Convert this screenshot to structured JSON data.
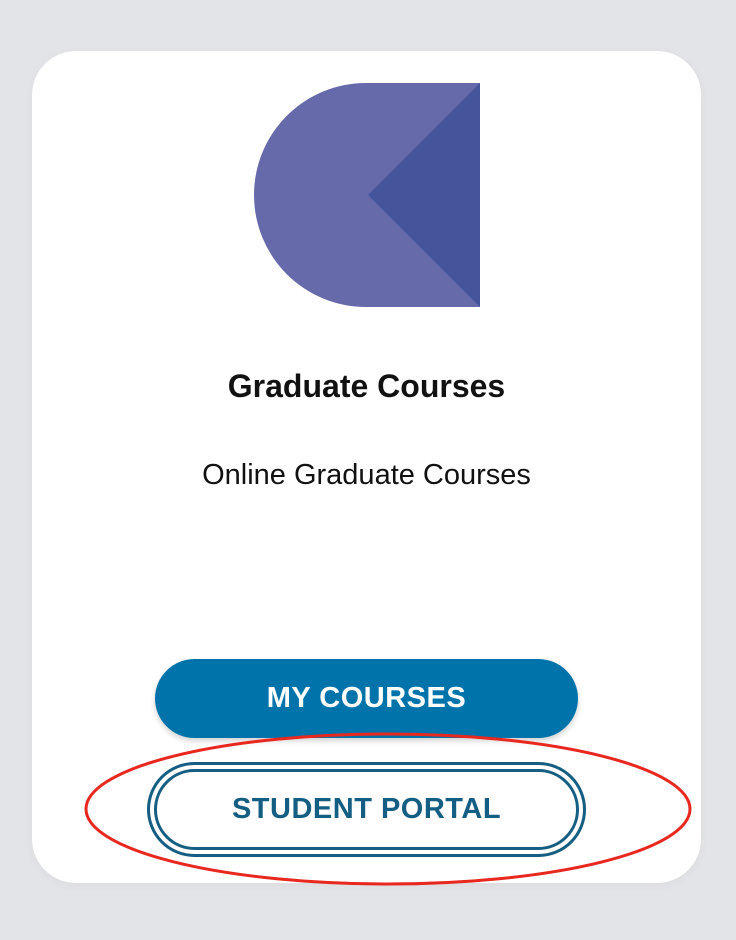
{
  "card": {
    "title": "Graduate Courses",
    "subtitle": "Online Graduate Courses",
    "logo_icon": "graduate-courses-logo-icon",
    "buttons": {
      "my_courses": "MY COURSES",
      "student_portal": "STUDENT PORTAL"
    }
  },
  "colors": {
    "page_background": "#e3e4e8",
    "card_background": "#ffffff",
    "logo_light": "#676aaa",
    "logo_dark": "#44559c",
    "primary_button": "#0074aa",
    "secondary_button_border": "#135e82",
    "annotation": "#e8271e"
  },
  "annotation": {
    "highlighted_element": "student-portal-button",
    "shape": "ellipse"
  }
}
